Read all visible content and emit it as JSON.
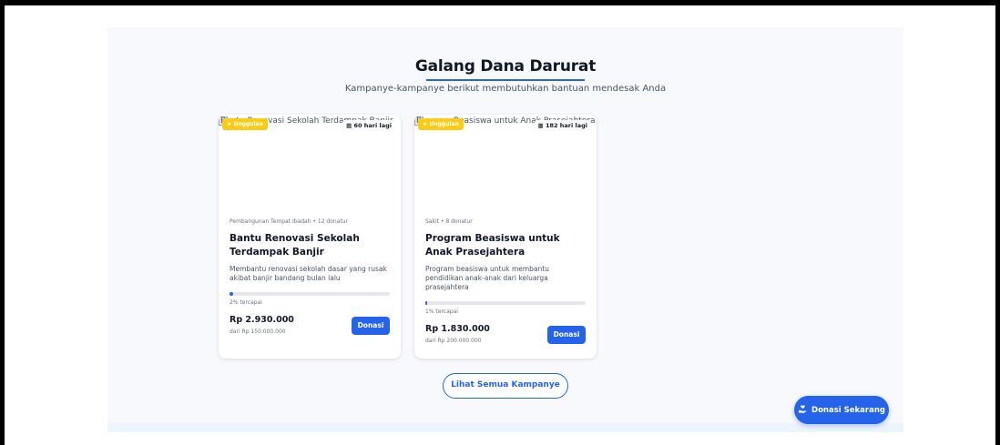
{
  "section": {
    "title": "Galang Dana Darurat",
    "subtitle": "Kampanye-kampanye berikut membutuhkan bantuan mendesak Anda"
  },
  "campaigns": [
    {
      "image_alt": "Bantu Renovasi Sekolah Terdampak Banjir",
      "featured_label": "Unggulan",
      "days_left": "60 hari lagi",
      "category": "Pembangunan Tempat Ibadah",
      "donors": "12 donatur",
      "title": "Bantu Renovasi Sekolah Terdampak Banjir",
      "description": "Membantu renovasi sekolah dasar yang rusak akibat banjir bandang bulan lalu",
      "progress_percent": 2,
      "progress_label": "2% tercapai",
      "amount": "Rp 2.930.000",
      "target": "dari Rp 150.000.000",
      "donate_label": "Donasi"
    },
    {
      "image_alt": "Program Beasiswa untuk Anak Prasejahtera",
      "featured_label": "Unggulan",
      "days_left": "182 hari lagi",
      "category": "Sakit",
      "donors": "8 donatur",
      "title": "Program Beasiswa untuk Anak Prasejahtera",
      "description": "Program beasiswa untuk membantu pendidikan anak-anak dari keluarga prasejahtera",
      "progress_percent": 1,
      "progress_label": "1% tercapai",
      "amount": "Rp 1.830.000",
      "target": "dari Rp 200.000.000",
      "donate_label": "Donasi"
    }
  ],
  "see_all_label": "Lihat Semua Kampanye",
  "fab_label": "Donasi Sekarang",
  "colors": {
    "accent": "#2563eb",
    "featured": "#facc15"
  },
  "icons": {
    "featured": "star-icon",
    "calendar": "calendar-icon",
    "donate": "hand-heart-icon"
  }
}
